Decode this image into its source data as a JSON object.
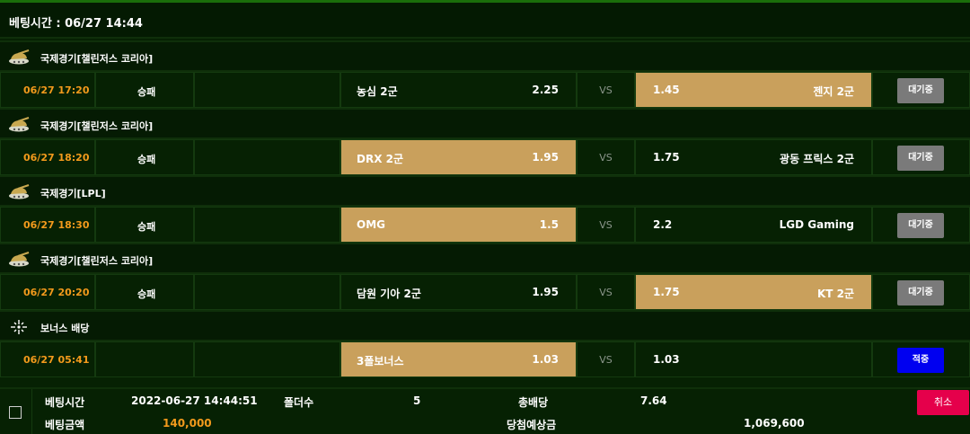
{
  "header": {
    "title": "베팅시간 : 06/27 14:44"
  },
  "vs_label": "VS",
  "colors": {
    "accent_orange": "#f39a1c",
    "selected_bg": "#c9a05c",
    "status_button": "#7a7a7a",
    "hit_button": "#0000f0",
    "cancel_button": "#e5004b"
  },
  "groups": [
    {
      "league": "국제경기[챌린저스 코리아]",
      "icon": "tank-icon",
      "match": {
        "time": "06/27 17:20",
        "type": "승패",
        "home": "농심 2군",
        "home_odds": "2.25",
        "away_odds": "1.45",
        "away": "젠지 2군",
        "selected": "away",
        "status": "대기중"
      }
    },
    {
      "league": "국제경기[챌린저스 코리아]",
      "icon": "tank-icon",
      "match": {
        "time": "06/27 18:20",
        "type": "승패",
        "home": "DRX 2군",
        "home_odds": "1.95",
        "away_odds": "1.75",
        "away": "광동 프릭스 2군",
        "selected": "home",
        "status": "대기중"
      }
    },
    {
      "league": "국제경기[LPL]",
      "icon": "tank-icon",
      "match": {
        "time": "06/27 18:30",
        "type": "승패",
        "home": "OMG",
        "home_odds": "1.5",
        "away_odds": "2.2",
        "away": "LGD Gaming",
        "selected": "home",
        "status": "대기중"
      }
    },
    {
      "league": "국제경기[챌린저스 코리아]",
      "icon": "tank-icon",
      "match": {
        "time": "06/27 20:20",
        "type": "승패",
        "home": "담원 기아 2군",
        "home_odds": "1.95",
        "away_odds": "1.75",
        "away": "KT 2군",
        "selected": "away",
        "status": "대기중"
      }
    },
    {
      "league": "보너스 배당",
      "icon": "bonus-sparkle-icon",
      "match": {
        "time": "06/27 05:41",
        "type": "",
        "home": "3폴보너스",
        "home_odds": "1.03",
        "away_odds": "1.03",
        "away": "",
        "selected": "home",
        "status": "적중"
      }
    }
  ],
  "footer": {
    "bet_time_label": "베팅시간",
    "bet_time_value": "2022-06-27 14:44:51",
    "folder_label": "폴더수",
    "folder_value": "5",
    "total_odds_label": "총배당",
    "total_odds_value": "7.64",
    "bet_amount_label": "베팅금액",
    "bet_amount_value": "140,000",
    "expected_label": "당첨예상금",
    "expected_value": "1,069,600",
    "cancel_label": "취소"
  }
}
